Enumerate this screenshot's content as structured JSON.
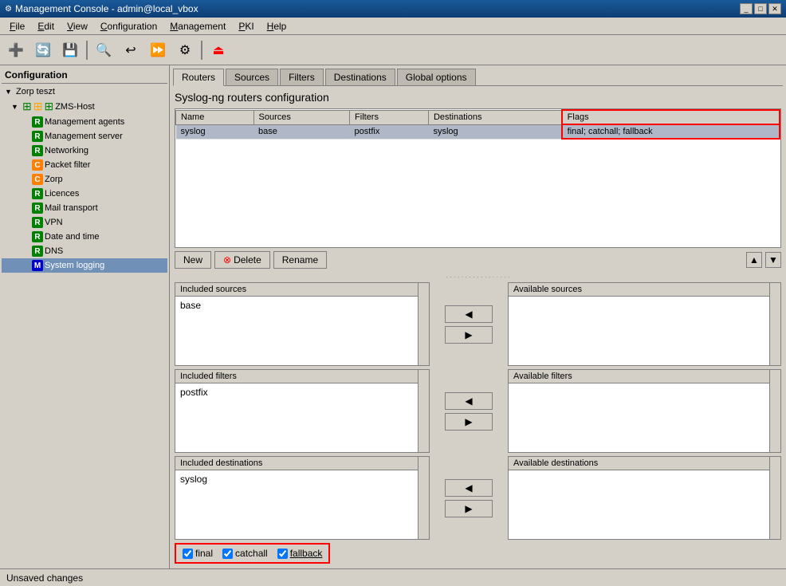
{
  "titleBar": {
    "title": "Management Console - admin@local_vbox",
    "icon": "⚙"
  },
  "menuBar": {
    "items": [
      {
        "label": "File",
        "underline": "F"
      },
      {
        "label": "Edit",
        "underline": "E"
      },
      {
        "label": "View",
        "underline": "V"
      },
      {
        "label": "Configuration",
        "underline": "C"
      },
      {
        "label": "Management",
        "underline": "M"
      },
      {
        "label": "PKI",
        "underline": "P"
      },
      {
        "label": "Help",
        "underline": "H"
      }
    ]
  },
  "sidebar": {
    "title": "Configuration",
    "items": [
      {
        "id": "zorp-teszt",
        "label": "Zorp teszt",
        "indent": 0,
        "type": "root",
        "arrow": "▼"
      },
      {
        "id": "zms-host",
        "label": "ZMS-Host",
        "indent": 1,
        "type": "host",
        "arrow": "▼"
      },
      {
        "id": "mgmt-agents",
        "label": "Management agents",
        "indent": 2,
        "iconType": "r"
      },
      {
        "id": "mgmt-server",
        "label": "Management server",
        "indent": 2,
        "iconType": "r"
      },
      {
        "id": "networking",
        "label": "Networking",
        "indent": 2,
        "iconType": "r"
      },
      {
        "id": "packet-filter",
        "label": "Packet filter",
        "indent": 2,
        "iconType": "c"
      },
      {
        "id": "zorp",
        "label": "Zorp",
        "indent": 2,
        "iconType": "c"
      },
      {
        "id": "licences",
        "label": "Licences",
        "indent": 2,
        "iconType": "r"
      },
      {
        "id": "mail-transport",
        "label": "Mail transport",
        "indent": 2,
        "iconType": "r"
      },
      {
        "id": "vpn",
        "label": "VPN",
        "indent": 2,
        "iconType": "r"
      },
      {
        "id": "date-time",
        "label": "Date and time",
        "indent": 2,
        "iconType": "r"
      },
      {
        "id": "dns",
        "label": "DNS",
        "indent": 2,
        "iconType": "r"
      },
      {
        "id": "system-logging",
        "label": "System logging",
        "indent": 2,
        "iconType": "m",
        "selected": true
      }
    ]
  },
  "tabs": {
    "items": [
      "Routers",
      "Sources",
      "Filters",
      "Destinations",
      "Global options"
    ],
    "active": 0
  },
  "contentTitle": "Syslog-ng routers configuration",
  "table": {
    "columns": [
      "Name",
      "Sources",
      "Filters",
      "Destinations",
      "Flags"
    ],
    "rows": [
      {
        "name": "syslog",
        "sources": "base",
        "filters": "postfix",
        "destinations": "syslog",
        "flags": "final; catchall; fallback",
        "selected": true
      }
    ]
  },
  "buttons": {
    "new": "New",
    "delete": "Delete",
    "rename": "Rename"
  },
  "includedSources": {
    "title": "Included sources",
    "items": [
      "base"
    ]
  },
  "includedFilters": {
    "title": "Included filters",
    "items": [
      "postfix"
    ]
  },
  "includedDestinations": {
    "title": "Included destinations",
    "items": [
      "syslog"
    ]
  },
  "availableSources": {
    "title": "Available sources",
    "items": []
  },
  "availableFilters": {
    "title": "Available filters",
    "items": []
  },
  "availableDestinations": {
    "title": "Available destinations",
    "items": []
  },
  "flags": {
    "final": {
      "label": "final",
      "checked": true
    },
    "catchall": {
      "label": "catchall",
      "checked": true
    },
    "fallback": {
      "label": "fallback",
      "checked": true,
      "underline": true
    }
  },
  "statusBar": {
    "text": "Unsaved changes"
  }
}
